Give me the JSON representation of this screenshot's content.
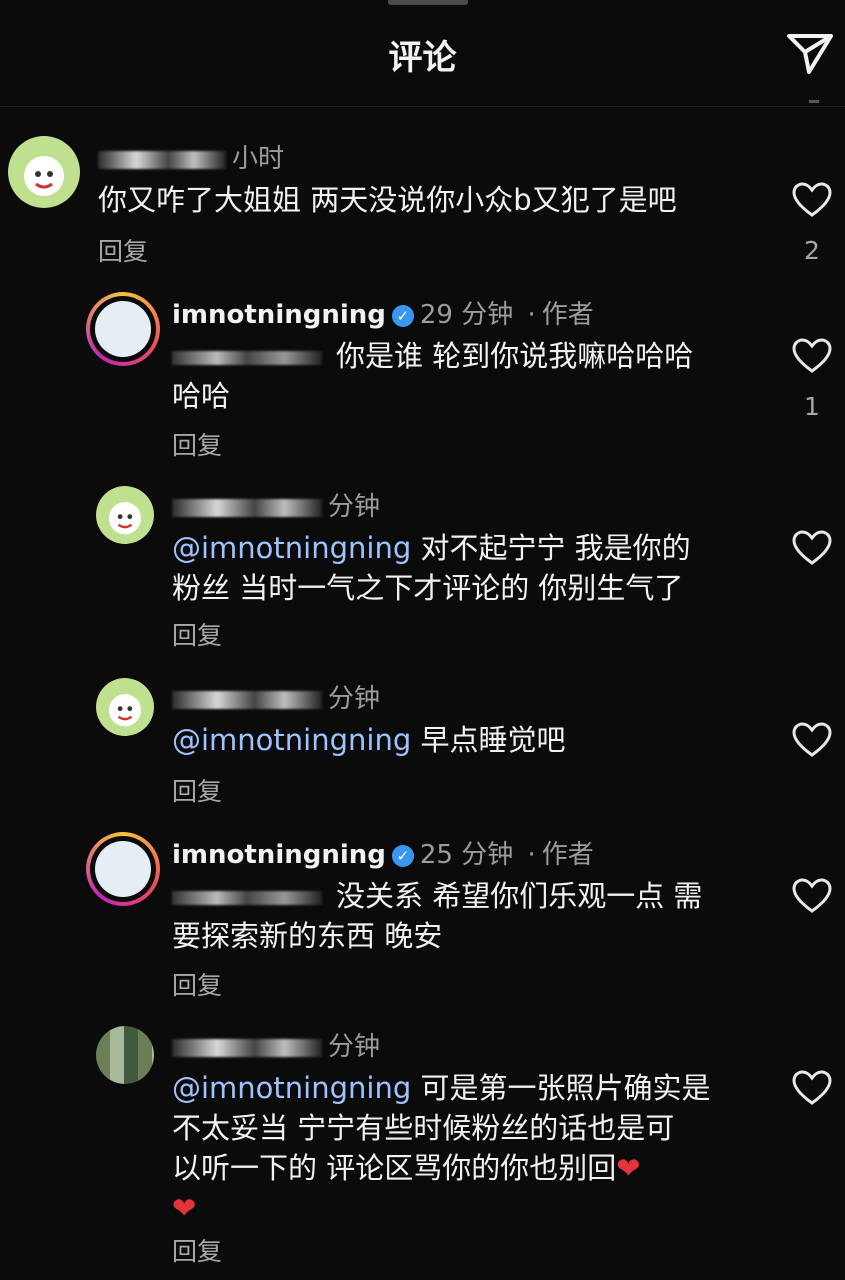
{
  "header": {
    "title": "评论"
  },
  "comments": [
    {
      "time": "小时",
      "text": "你又咋了大姐姐 两天没说你小众b又犯了是吧",
      "reply": "回复",
      "likes": "2"
    },
    {
      "username": "imnotningning",
      "verified": "✓",
      "time": "29 分钟",
      "dot": "·",
      "author": "作者",
      "text_line1": "你是谁 轮到你说我嘛哈哈哈",
      "text_line2": "哈哈",
      "reply": "回复",
      "likes": "1"
    },
    {
      "time": "分钟",
      "mention": "@imnotningning",
      "text_line1": "对不起宁宁 我是你的",
      "text_line2": "粉丝 当时一气之下才评论的 你别生气了",
      "reply": "回复"
    },
    {
      "time": "分钟",
      "mention": "@imnotningning",
      "text_line1": "早点睡觉吧",
      "reply": "回复"
    },
    {
      "username": "imnotningning",
      "verified": "✓",
      "time": "25 分钟",
      "dot": "·",
      "author": "作者",
      "text_line1": "没关系 希望你们乐观一点 需",
      "text_line2": "要探索新的东西 晚安",
      "reply": "回复"
    },
    {
      "time": "分钟",
      "mention": "@imnotningning",
      "text_line1": "可是第一张照片确实是",
      "text_line2": "不太妥当 宁宁有些时候粉丝的话也是可",
      "text_line3": "以听一下的 评论区骂你的你也别回",
      "emoji": "❤",
      "reply": "回复"
    }
  ],
  "icons": {
    "share": "paper-plane-icon",
    "like": "heart-outline-icon"
  },
  "colors": {
    "background": "#0b0b0c",
    "mention": "#9ec2ff",
    "verified": "#3897f0",
    "heart": "#e2343a"
  }
}
